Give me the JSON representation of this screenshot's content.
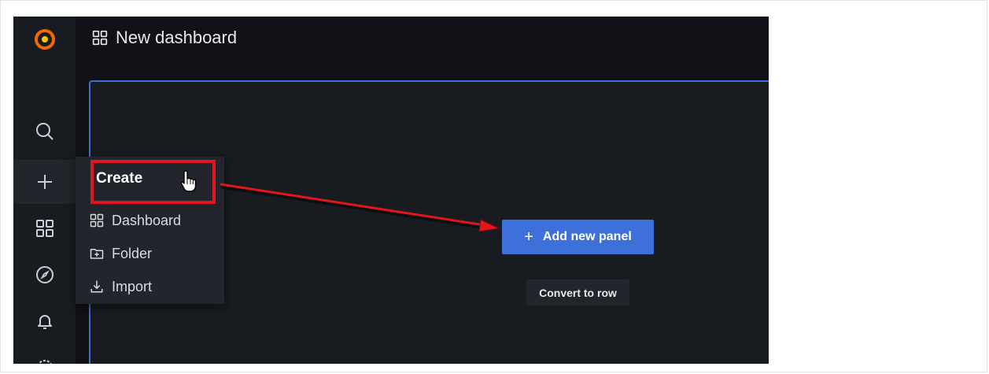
{
  "topbar": {
    "title": "New dashboard",
    "title_icon": "dashboard-grid-icon"
  },
  "sidebar": {
    "items": [
      {
        "name": "grafana-logo",
        "icon": "grafana-logo"
      },
      {
        "name": "search",
        "icon": "search-icon"
      },
      {
        "name": "create",
        "icon": "plus-icon"
      },
      {
        "name": "dashboards",
        "icon": "dashboard-grid-icon"
      },
      {
        "name": "explore",
        "icon": "compass-icon"
      },
      {
        "name": "alerting",
        "icon": "bell-icon"
      },
      {
        "name": "settings",
        "icon": "gear-icon"
      }
    ]
  },
  "create_menu": {
    "header": "Create",
    "items": [
      {
        "label": "Dashboard",
        "icon": "dashboard-grid-icon"
      },
      {
        "label": "Folder",
        "icon": "folder-plus-icon"
      },
      {
        "label": "Import",
        "icon": "import-icon"
      }
    ]
  },
  "panel": {
    "add_button": "Add new panel",
    "convert_button": "Convert to row"
  },
  "colors": {
    "accent": "#3d71d9",
    "annotation": "#e0161c",
    "background": "#111217",
    "sidebar": "#181b1f"
  }
}
